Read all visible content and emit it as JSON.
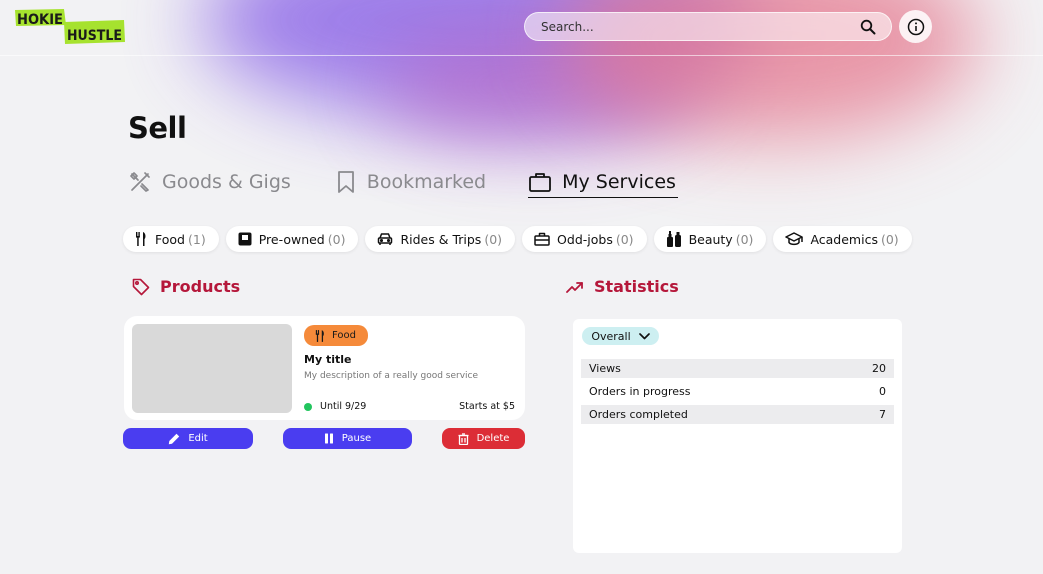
{
  "header": {
    "logo_line1": "HOKIE",
    "logo_line2": "HUSTLE",
    "search_placeholder": "Search...",
    "brand_color": "#a6e22e"
  },
  "page": {
    "title": "Sell"
  },
  "tabs": [
    {
      "label": "Goods & Gigs",
      "icon": "tools-icon",
      "active": false
    },
    {
      "label": "Bookmarked",
      "icon": "bookmark-icon",
      "active": false
    },
    {
      "label": "My Services",
      "icon": "briefcase-icon",
      "active": true
    }
  ],
  "categories": [
    {
      "label": "Food",
      "count": "(1)",
      "icon": "utensils-icon"
    },
    {
      "label": "Pre-owned",
      "count": "(0)",
      "icon": "box-icon"
    },
    {
      "label": "Rides & Trips",
      "count": "(0)",
      "icon": "car-icon"
    },
    {
      "label": "Odd-jobs",
      "count": "(0)",
      "icon": "toolbox-icon"
    },
    {
      "label": "Beauty",
      "count": "(0)",
      "icon": "bottles-icon"
    },
    {
      "label": "Academics",
      "count": "(0)",
      "icon": "graduation-cap-icon"
    }
  ],
  "products": {
    "heading": "Products",
    "item": {
      "category": "Food",
      "title": "My title",
      "description": "My description of a really good service",
      "status": "Until 9/29",
      "price": "Starts at $5"
    },
    "actions": {
      "edit": "Edit",
      "pause": "Pause",
      "delete": "Delete"
    }
  },
  "statistics": {
    "heading": "Statistics",
    "filter": "Overall",
    "rows": [
      {
        "label": "Views",
        "value": "20"
      },
      {
        "label": "Orders in progress",
        "value": "0"
      },
      {
        "label": "Orders completed",
        "value": "7"
      }
    ]
  },
  "colors": {
    "accent": "#b5173a",
    "primary_button": "#4a3df0",
    "danger_button": "#dc2d36",
    "food_badge": "#f58a3a",
    "status_active": "#22c55e"
  }
}
